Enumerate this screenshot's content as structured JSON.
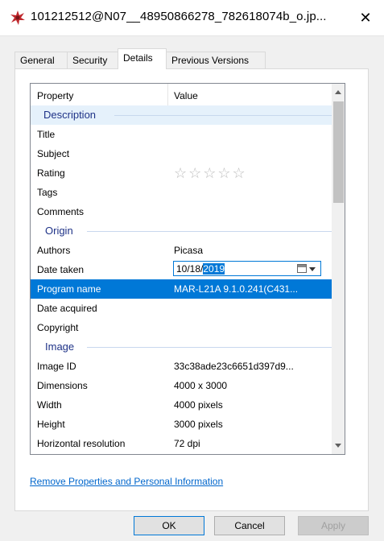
{
  "window": {
    "title": "101212512@N07__48950866278_782618074b_o.jp...",
    "close_glyph": "✕",
    "icon": "photo-file-icon"
  },
  "tabs": [
    {
      "label": "General"
    },
    {
      "label": "Security"
    },
    {
      "label": "Details",
      "active": true
    },
    {
      "label": "Previous Versions"
    }
  ],
  "table": {
    "header_property": "Property",
    "header_value": "Value",
    "groups": {
      "description": "Description",
      "origin": "Origin",
      "image": "Image"
    },
    "rows": {
      "title": {
        "property": "Title",
        "value": ""
      },
      "subject": {
        "property": "Subject",
        "value": ""
      },
      "rating": {
        "property": "Rating",
        "stars": "☆☆☆☆☆"
      },
      "tags": {
        "property": "Tags",
        "value": ""
      },
      "comments": {
        "property": "Comments",
        "value": ""
      },
      "authors": {
        "property": "Authors",
        "value": "Picasa"
      },
      "date_taken": {
        "property": "Date taken",
        "value_prefix": "10/18/",
        "value_selected": "2019"
      },
      "program_name": {
        "property": "Program name",
        "value": "MAR-L21A 9.1.0.241(C431..."
      },
      "date_acquired": {
        "property": "Date acquired",
        "value": ""
      },
      "copyright": {
        "property": "Copyright",
        "value": ""
      },
      "image_id": {
        "property": "Image ID",
        "value": "33c38ade23c6651d397d9..."
      },
      "dimensions": {
        "property": "Dimensions",
        "value": "4000 x 3000"
      },
      "width": {
        "property": "Width",
        "value": "4000 pixels"
      },
      "height": {
        "property": "Height",
        "value": "3000 pixels"
      },
      "horizontal_resolution": {
        "property": "Horizontal resolution",
        "value": "72 dpi"
      }
    }
  },
  "link": {
    "label": "Remove Properties and Personal Information"
  },
  "buttons": {
    "ok": "OK",
    "cancel": "Cancel",
    "apply": "Apply"
  },
  "colors": {
    "accent": "#0078d7",
    "group_text": "#1e3287",
    "link": "#0066cc"
  }
}
